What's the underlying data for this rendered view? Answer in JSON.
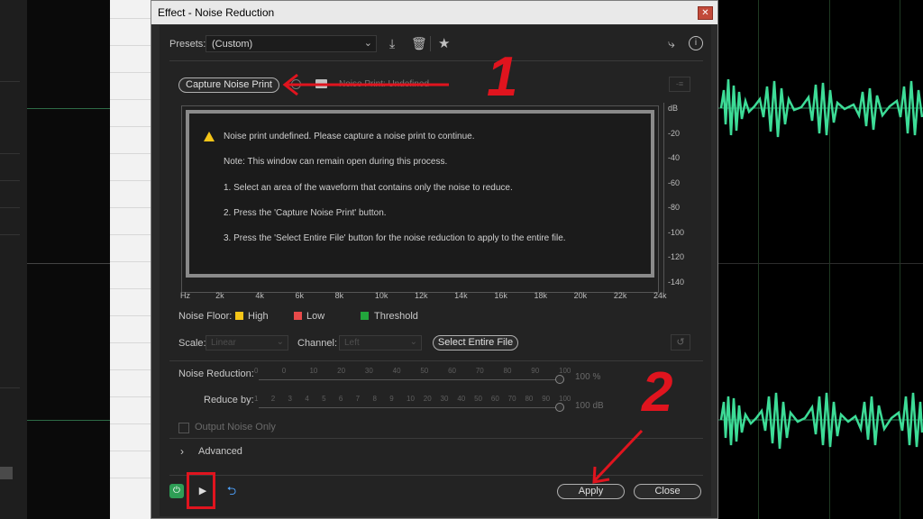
{
  "window": {
    "title": "Effect - Noise Reduction",
    "close_glyph": "✕"
  },
  "presets": {
    "label": "Presets:",
    "value": "(Custom)"
  },
  "capture": {
    "button": "Capture Noise Print",
    "status": "Noise Print: Undefined"
  },
  "messages": [
    "Noise print undefined. Please capture a noise print to continue.",
    "Note: This window can remain open during this process.",
    "1. Select an area of the waveform that contains only the noise to reduce.",
    "2. Press the 'Capture Noise Print' button.",
    "3. Press the 'Select Entire File' button for the noise reduction to apply to the entire file."
  ],
  "x_axis": [
    "Hz",
    "2k",
    "4k",
    "6k",
    "8k",
    "10k",
    "12k",
    "14k",
    "16k",
    "18k",
    "20k",
    "22k",
    "24k"
  ],
  "y_axis": [
    "dB",
    "-20",
    "-40",
    "-60",
    "-80",
    "-100",
    "-120",
    "-140"
  ],
  "legend": {
    "label": "Noise Floor:",
    "items": [
      {
        "name": "High",
        "color": "#f5c518"
      },
      {
        "name": "Low",
        "color": "#e84a4a"
      },
      {
        "name": "Threshold",
        "color": "#22a63c"
      }
    ]
  },
  "scale": {
    "label": "Scale:",
    "value": "Linear"
  },
  "channel": {
    "label": "Channel:",
    "value": "Left"
  },
  "select_entire_file": "Select Entire File",
  "noise_reduction": {
    "label": "Noise Reduction:",
    "ticks": [
      "0",
      "0",
      "10",
      "20",
      "30",
      "40",
      "50",
      "60",
      "70",
      "80",
      "90",
      "100"
    ],
    "value": "100 %",
    "level": 1.0
  },
  "reduce_by": {
    "label": "Reduce by:",
    "ticks": [
      "1",
      "2",
      "3",
      "4",
      "5",
      "6",
      "7",
      "8",
      "9",
      "10",
      "20",
      "30",
      "40",
      "50",
      "60",
      "70",
      "80",
      "90",
      "100"
    ],
    "value": "100 dB",
    "level": 1.0
  },
  "output_noise_only": "Output Noise Only",
  "advanced": "Advanced",
  "footer": {
    "apply": "Apply",
    "close": "Close"
  },
  "annotations": {
    "one": "1",
    "two": "2"
  },
  "colors": {
    "waveform": "#3ddc97",
    "annotation": "#e0141e"
  }
}
